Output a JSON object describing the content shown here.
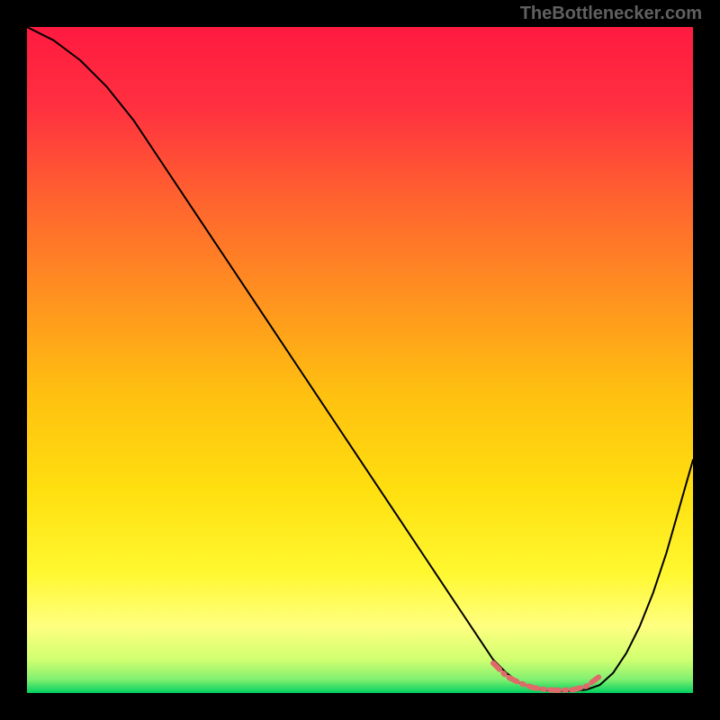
{
  "watermark": "TheBottlenecker.com",
  "chart_data": {
    "type": "line",
    "title": "",
    "xlabel": "",
    "ylabel": "",
    "xlim": [
      0,
      100
    ],
    "ylim": [
      0,
      100
    ],
    "grid": false,
    "legend": false,
    "background": {
      "type": "vertical-gradient",
      "stops": [
        {
          "offset": 0.0,
          "color": "#ff1a40"
        },
        {
          "offset": 0.12,
          "color": "#ff3040"
        },
        {
          "offset": 0.25,
          "color": "#ff6030"
        },
        {
          "offset": 0.4,
          "color": "#ff9020"
        },
        {
          "offset": 0.55,
          "color": "#ffc010"
        },
        {
          "offset": 0.7,
          "color": "#ffe010"
        },
        {
          "offset": 0.82,
          "color": "#fff830"
        },
        {
          "offset": 0.9,
          "color": "#ffff80"
        },
        {
          "offset": 0.95,
          "color": "#d0ff70"
        },
        {
          "offset": 0.98,
          "color": "#80f070"
        },
        {
          "offset": 1.0,
          "color": "#00d060"
        }
      ]
    },
    "series": [
      {
        "name": "bottleneck-curve",
        "color": "#000000",
        "width": 2,
        "x": [
          0,
          4,
          8,
          12,
          16,
          20,
          24,
          28,
          32,
          36,
          40,
          44,
          48,
          52,
          56,
          60,
          64,
          68,
          70,
          72,
          74,
          76,
          78,
          80,
          82,
          84,
          86,
          88,
          90,
          92,
          94,
          96,
          98,
          100
        ],
        "y": [
          100,
          98,
          95,
          91,
          86,
          80,
          74,
          68,
          62,
          56,
          50,
          44,
          38,
          32,
          26,
          20,
          14,
          8,
          5,
          3,
          1.5,
          0.8,
          0.4,
          0.3,
          0.3,
          0.5,
          1.2,
          3,
          6,
          10,
          15,
          21,
          28,
          35
        ]
      },
      {
        "name": "optimal-zone",
        "color": "#e06a6a",
        "width": 6,
        "style": "dash-dot",
        "x": [
          70,
          72,
          74,
          76,
          78,
          80,
          82,
          84,
          86
        ],
        "y": [
          4.5,
          2.5,
          1.5,
          0.8,
          0.5,
          0.4,
          0.5,
          1.0,
          2.5
        ]
      }
    ]
  }
}
